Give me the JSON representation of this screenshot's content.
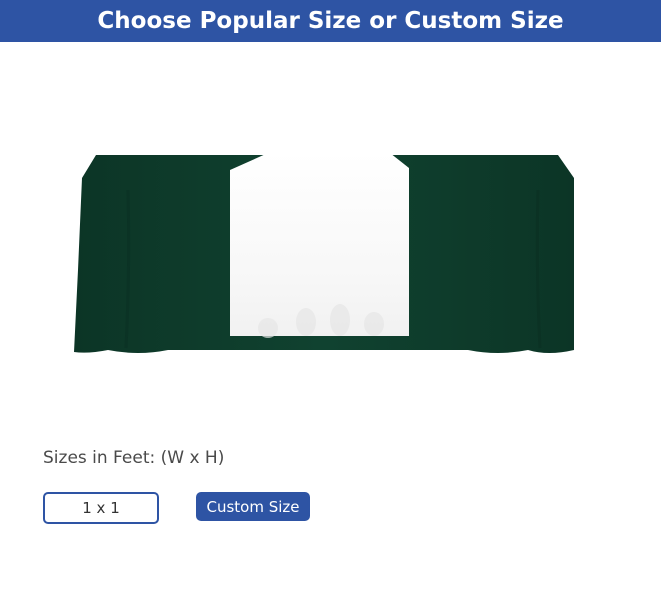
{
  "header": {
    "title": "Choose Popular Size or Custom Size"
  },
  "product": {
    "table_color": "#0f3d2b",
    "runner_color": "#ffffff"
  },
  "sizes": {
    "label": "Sizes in Feet: (W x H)",
    "options": [
      "1 x 1"
    ],
    "custom_label": "Custom Size"
  },
  "colors": {
    "accent": "#2e54a4"
  }
}
